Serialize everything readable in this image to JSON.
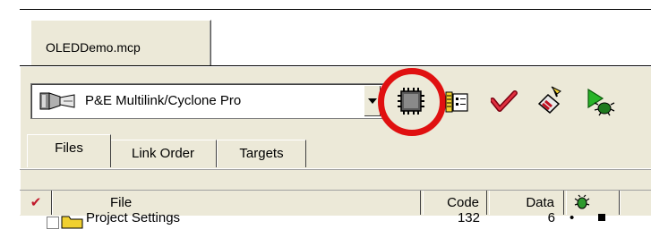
{
  "project_tab": {
    "label": "OLEDDemo.mcp"
  },
  "target_select": {
    "value": "P&E Multilink/Cyclone Pro",
    "icon": "connector-icon"
  },
  "toolbar": {
    "items": [
      {
        "icon": "chip-icon",
        "highlighted": true
      },
      {
        "icon": "settings-sheet-icon"
      },
      {
        "icon": "check-icon"
      },
      {
        "icon": "make-icon"
      },
      {
        "icon": "debug-icon"
      }
    ],
    "highlight_color": "#e01010"
  },
  "tabs": [
    {
      "label": "Files",
      "active": true
    },
    {
      "label": "Link Order",
      "active": false
    },
    {
      "label": "Targets",
      "active": false
    }
  ],
  "table": {
    "columns": {
      "check": "✔",
      "file": "File",
      "code": "Code",
      "data": "Data"
    },
    "rows": [
      {
        "name": "Project Settings",
        "code": "132",
        "data": "6",
        "dot": "•"
      }
    ]
  },
  "colors": {
    "panel": "#ece9d8",
    "check": "#c0182a",
    "bug": "#2e9a2e"
  }
}
